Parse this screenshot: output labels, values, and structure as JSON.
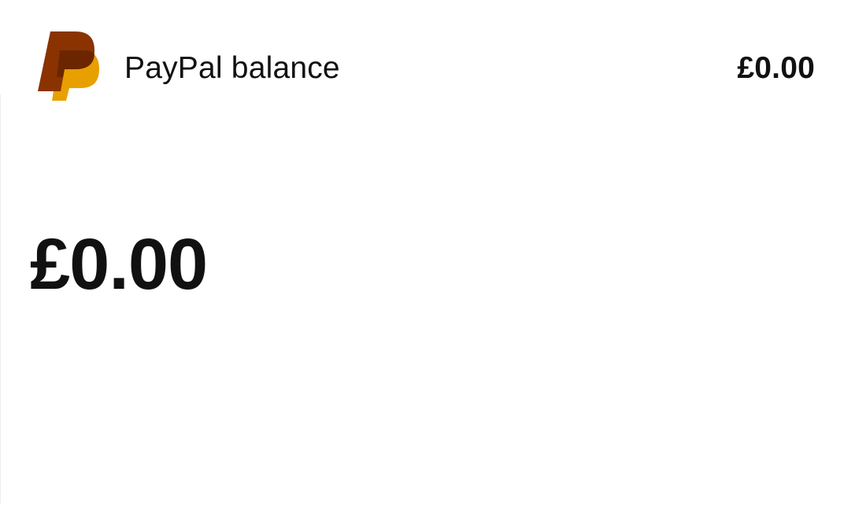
{
  "balance_row": {
    "logo_icon": "paypal-logo-icon",
    "label": "PayPal balance",
    "amount": "£0.00"
  },
  "main": {
    "balance_amount": "£0.00"
  },
  "colors": {
    "logo_dark": "#8a3300",
    "logo_mid": "#6b2600",
    "logo_light": "#e8a000",
    "text": "#111111",
    "background": "#ffffff"
  }
}
